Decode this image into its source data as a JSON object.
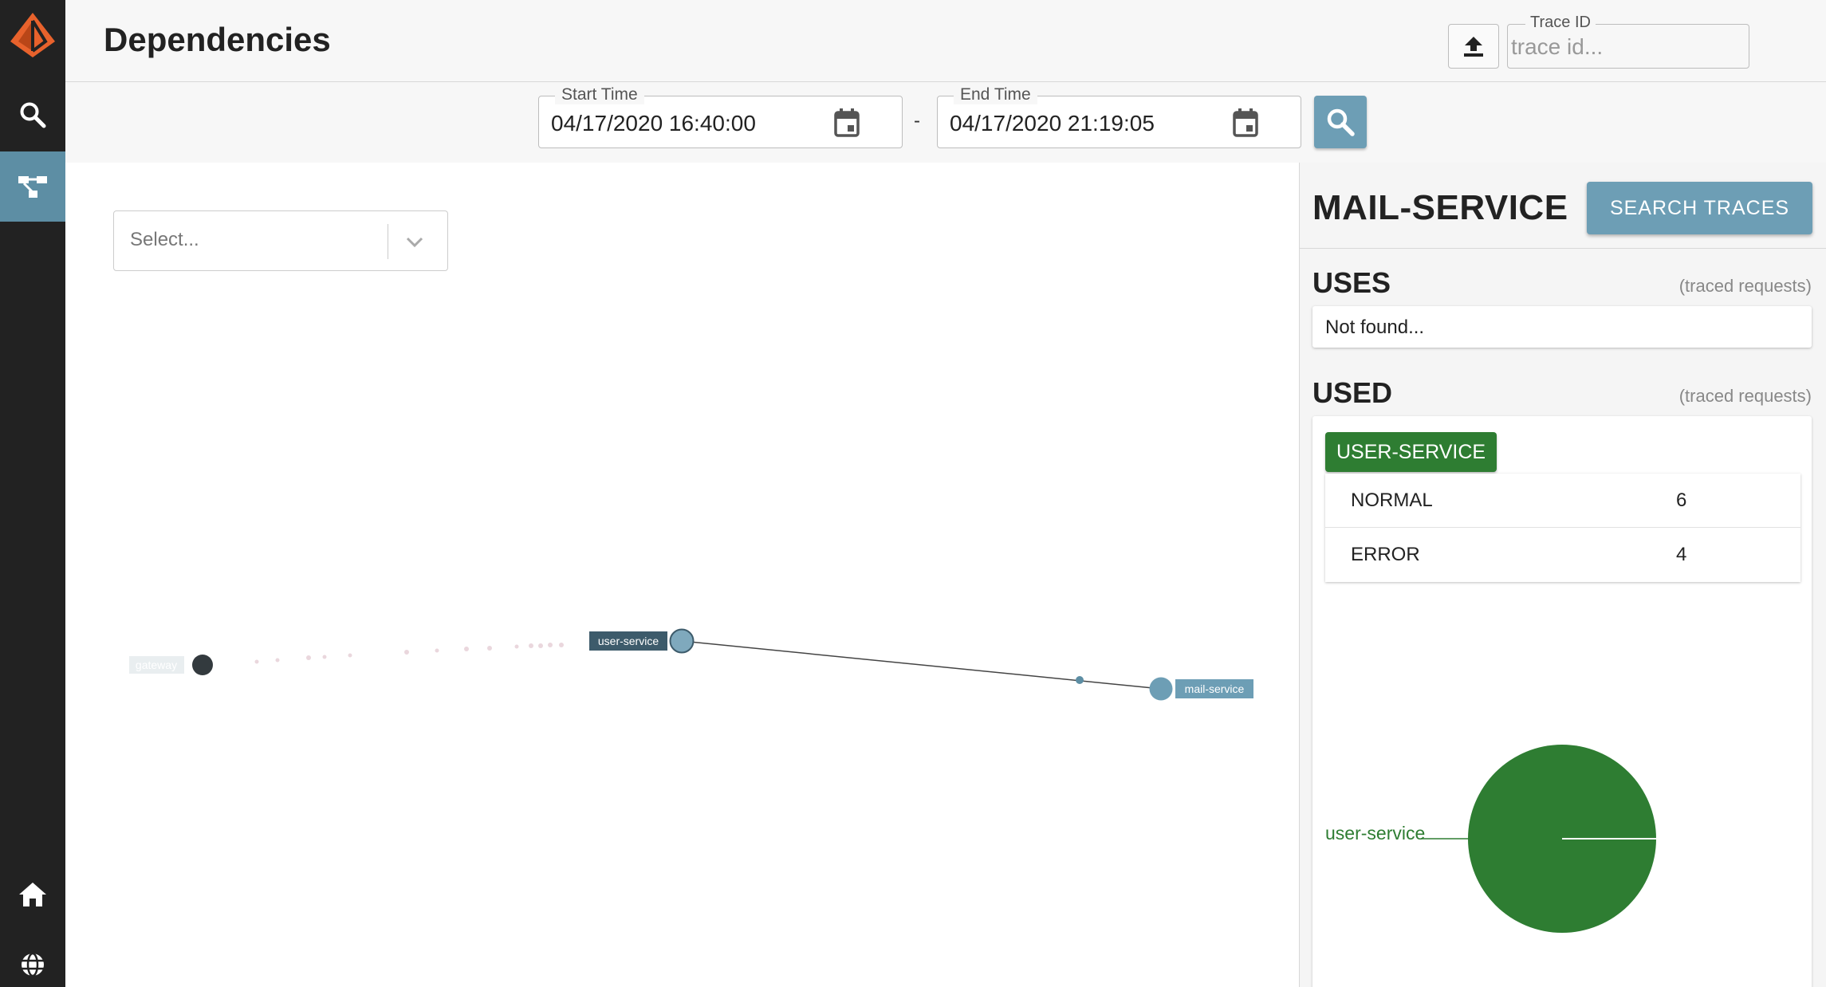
{
  "header": {
    "title": "Dependencies",
    "trace_id_label": "Trace ID",
    "trace_id_placeholder": "trace id..."
  },
  "timebar": {
    "start_label": "Start Time",
    "start_value": "04/17/2020 16:40:00",
    "end_label": "End Time",
    "end_value": "04/17/2020 21:19:05",
    "separator": "-"
  },
  "graph": {
    "select_placeholder": "Select...",
    "nodes": [
      {
        "label": "gateway"
      },
      {
        "label": "user-service"
      },
      {
        "label": "mail-service"
      }
    ]
  },
  "panel": {
    "service_name": "MAIL-SERVICE",
    "search_traces_label": "SEARCH TRACES",
    "uses_title": "USES",
    "uses_note": "(traced requests)",
    "uses_empty": "Not found...",
    "used_title": "USED",
    "used_note": "(traced requests)",
    "used_service": "USER-SERVICE",
    "stats": [
      {
        "label": "NORMAL",
        "value": "6"
      },
      {
        "label": "ERROR",
        "value": "4"
      }
    ],
    "pie_label": "user-service"
  },
  "colors": {
    "sidebar": "#222222",
    "accent": "#6d9eb5",
    "success": "#2e7d32",
    "logo": "#e8622c"
  },
  "icons": {
    "logo": "logo-icon",
    "search": "search-icon",
    "dependencies": "dependencies-icon",
    "home": "home-icon",
    "globe": "globe-icon",
    "upload": "upload-icon",
    "calendar": "calendar-icon",
    "chevron": "chevron-down-icon"
  }
}
